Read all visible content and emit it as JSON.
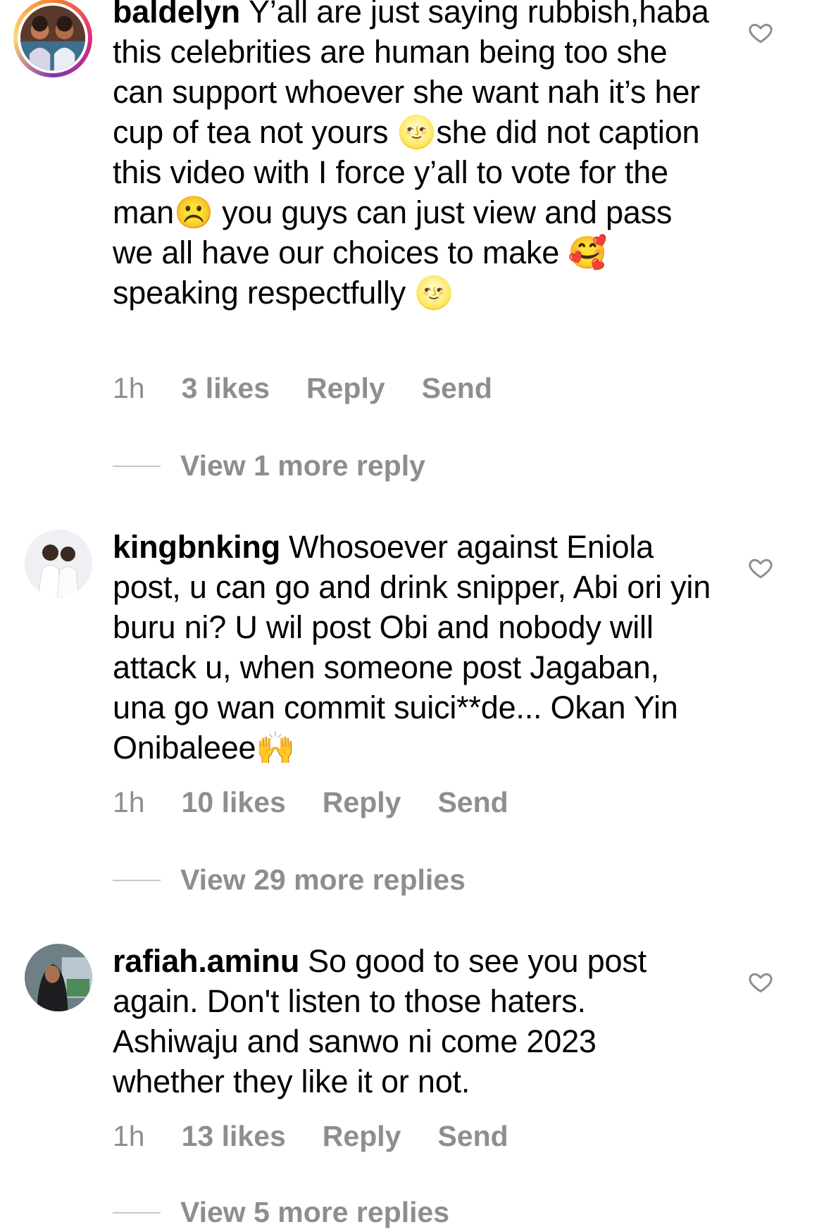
{
  "comments": [
    {
      "username": "baldelyn",
      "text": "Y’all are just saying rubbish,haba this celebrities are human being too she can support whoever she want nah it’s her cup of tea not yours 🌝she did not caption this video with I force y’all to vote for the man☹️ you guys can just view and pass we all have our choices to make 🥰speaking respectfully 🌝",
      "time": "1h",
      "likes": "3 likes",
      "reply": "Reply",
      "send": "Send",
      "view_more": "View 1 more reply",
      "avatar_icon": "profile-photo"
    },
    {
      "username": "kingbnking",
      "text": "Whosoever against Eniola post, u can go and drink snipper, Abi ori yin buru ni? U wil post Obi and nobody will attack u, when someone post Jagaban, una go wan commit suici**de... Okan Yin Onibaleee🙌",
      "time": "1h",
      "likes": "10 likes",
      "reply": "Reply",
      "send": "Send",
      "view_more": "View 29 more replies",
      "avatar_icon": "profile-photo"
    },
    {
      "username": "rafiah.aminu",
      "text": "So good to see you post again. Don't listen to those haters. Ashiwaju and sanwo ni come 2023 whether they like it or not.",
      "time": "1h",
      "likes": "13 likes",
      "reply": "Reply",
      "send": "Send",
      "view_more": "View 5 more replies",
      "avatar_icon": "profile-photo"
    }
  ],
  "colors": {
    "meta": "#8e8e8e",
    "divider": "#c7c7c7",
    "text": "#000000"
  },
  "icons": {
    "like": "heart-outline-icon"
  }
}
